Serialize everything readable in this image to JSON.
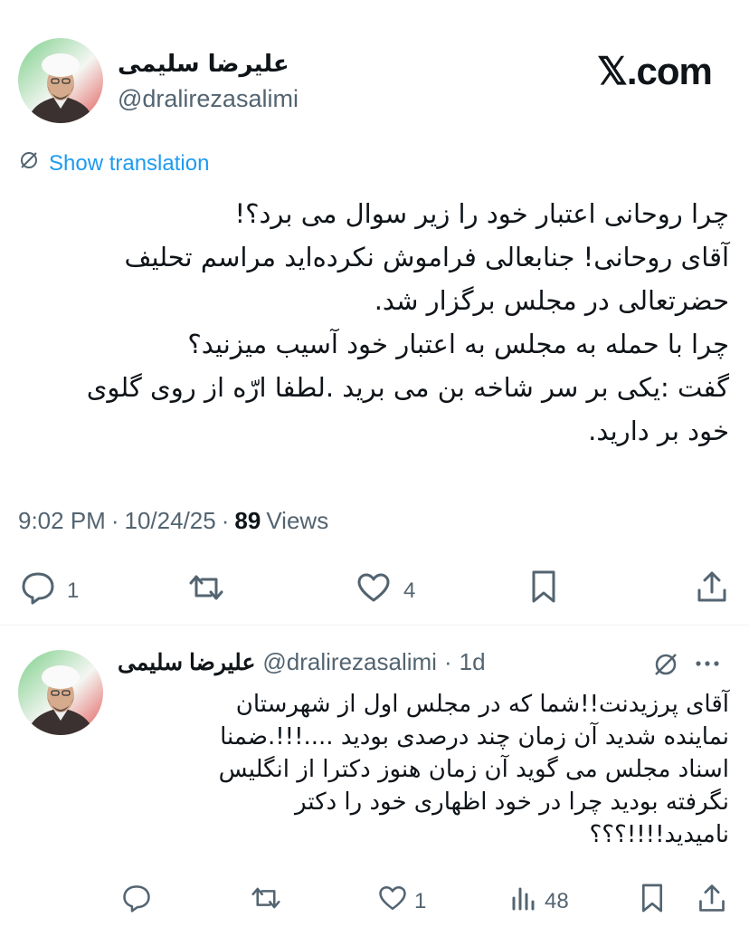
{
  "brand": {
    "logo_text": "𝕏.com"
  },
  "tweet": {
    "author_name": "علیرضا سلیمی",
    "author_handle": "@dralirezasalimi",
    "translation_label": "Show translation",
    "text_lines": [
      "چرا روحانی اعتبار خود را زیر سوال می برد؟!",
      "آقای روحانی! جنابعالی فراموش نکرده‌اید مراسم تحلیف",
      "حضرتعالی در مجلس برگزار شد.",
      "چرا با حمله به مجلس به اعتبار خود آسیب میزنید؟",
      "گفت :یکی بر سر شاخه بن می برید .لطفا ارّه از روی گلوی",
      "خود بر دارید."
    ],
    "time": "9:02 PM",
    "date": "10/24/25",
    "views_count": "89",
    "views_label": "Views",
    "reply_count": "1",
    "like_count": "4"
  },
  "reply": {
    "author_name": "علیرضا سلیمی",
    "author_handle": "@dralirezasalimi",
    "age": "1d",
    "text_lines": [
      "آقای پرزیدنت!!شما که در مجلس اول از شهرستان",
      "نماینده شدید آن زمان چند درصدی بودید ....!!!.ضمنا",
      "اسناد مجلس می گوید آن زمان هنوز دکترا از انگلیس",
      "نگرفته بودید چرا در خود اظهاری خود را دکتر",
      "نامیدید!!!!؟؟؟"
    ],
    "like_count": "1",
    "views_count": "48"
  },
  "icons": {
    "reply": "reply-icon",
    "retweet": "retweet-icon",
    "like": "heart-icon",
    "bookmark": "bookmark-icon",
    "share": "share-icon",
    "views": "views-icon",
    "translate": "translate-icon",
    "grok": "grok-icon",
    "more": "more-icon"
  },
  "colors": {
    "link": "#1d9bf0",
    "muted": "#536471",
    "text": "#0f1419"
  }
}
